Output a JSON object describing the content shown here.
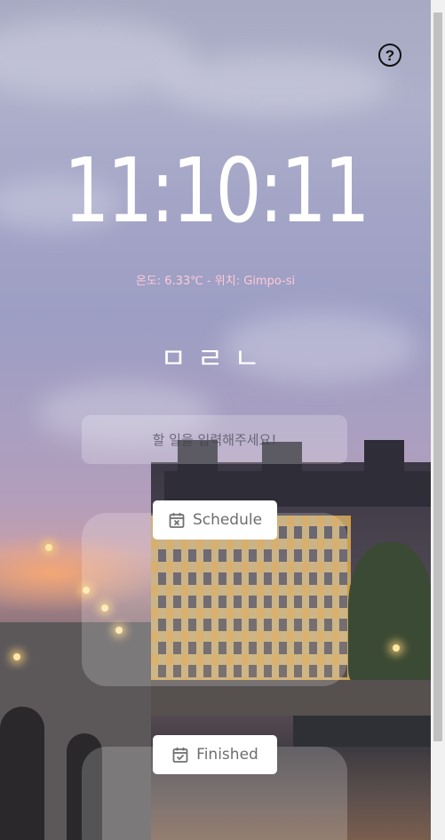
{
  "help": {
    "icon": "question-icon",
    "glyph": "?"
  },
  "clock": {
    "time": "11:10:11"
  },
  "weather": {
    "text": "온도: 6.33℃ - 위치: Gimpo-si"
  },
  "greeting": {
    "text": "ㅁㄹㄴ"
  },
  "todo_input": {
    "placeholder": "할 일을 입력해주세요!",
    "value": ""
  },
  "schedule": {
    "label": "Schedule",
    "icon": "calendar-x-icon"
  },
  "finished": {
    "label": "Finished",
    "icon": "calendar-check-icon"
  },
  "colors": {
    "weather_text": "#ffc9d6",
    "clock_text": "#ffffff",
    "button_bg": "#ffffff"
  }
}
